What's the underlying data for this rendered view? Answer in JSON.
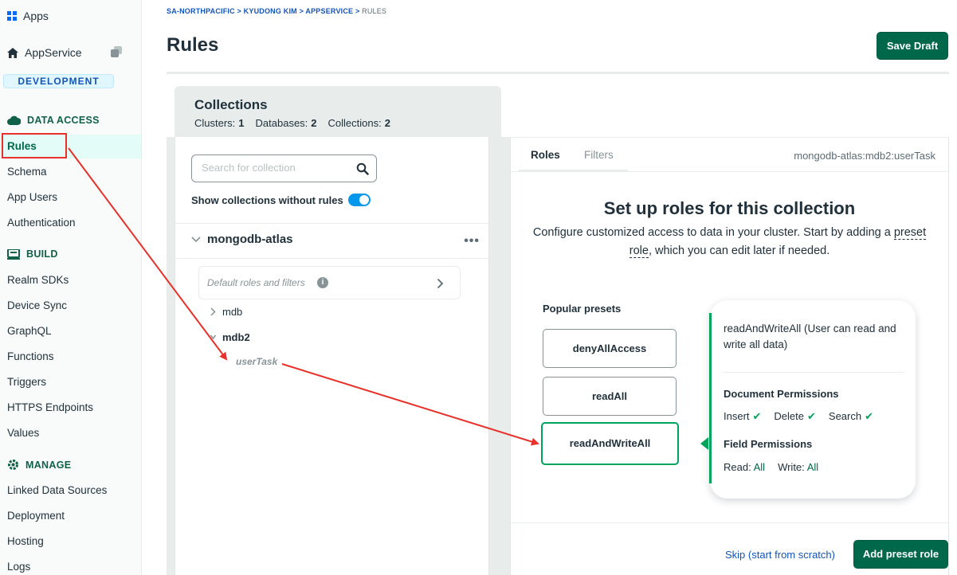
{
  "sidebar": {
    "apps_label": "Apps",
    "app_name": "AppService",
    "environment": "DEVELOPMENT",
    "sections": {
      "data_access": "DATA ACCESS",
      "build": "BUILD",
      "manage": "MANAGE"
    },
    "data_access_items": [
      "Rules",
      "Schema",
      "App Users",
      "Authentication"
    ],
    "build_items": [
      "Realm SDKs",
      "Device Sync",
      "GraphQL",
      "Functions",
      "Triggers",
      "HTTPS Endpoints",
      "Values"
    ],
    "manage_items": [
      "Linked Data Sources",
      "Deployment",
      "Hosting",
      "Logs"
    ]
  },
  "header": {
    "breadcrumb_links": "SA-NORTHPACIFIC > KYUDONG KIM > APPSERVICE >",
    "breadcrumb_current": "RULES",
    "title": "Rules",
    "save_label": "Save Draft"
  },
  "collections": {
    "title": "Collections",
    "clusters_label": "Clusters:",
    "clusters_value": "1",
    "databases_label": "Databases:",
    "databases_value": "2",
    "collections_label": "Collections:",
    "collections_value": "2",
    "search_placeholder": "Search for collection",
    "toggle_label": "Show collections without rules",
    "cluster_name": "mongodb-atlas",
    "more_icon": "•••",
    "default_roles": "Default roles and filters",
    "databases": [
      "mdb",
      "mdb2"
    ],
    "collection_leaf": "userTask"
  },
  "roles": {
    "tabs": [
      "Roles",
      "Filters"
    ],
    "namespace": "mongodb-atlas:mdb2:userTask",
    "setup_title": "Set up roles for this collection",
    "setup_desc_1": "Configure customized access to data in your cluster. Start by adding a",
    "setup_desc_link_a": "preset",
    "setup_desc_link_b": "role",
    "setup_desc_2": ", which you can edit later if needed.",
    "presets_label": "Popular presets",
    "presets": [
      "denyAllAccess",
      "readAll",
      "readAndWriteAll"
    ],
    "selected_preset": "readAndWriteAll",
    "card": {
      "description": "readAndWriteAll (User can read and write all data)",
      "doc_perm_heading": "Document Permissions",
      "doc_perms": [
        "Insert",
        "Delete",
        "Search"
      ],
      "field_perm_heading": "Field Permissions",
      "read_label": "Read:",
      "read_value": "All",
      "write_label": "Write:",
      "write_value": "All"
    },
    "skip_label": "Skip (start from scratch)",
    "add_label": "Add preset role"
  },
  "colors": {
    "brand_green": "#00684a",
    "accent_green": "#00a35c",
    "link_blue": "#1254b7",
    "annotation_red": "#e8312a"
  }
}
